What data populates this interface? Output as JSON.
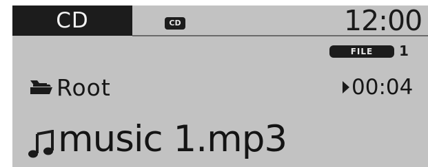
{
  "header": {
    "mode_label": "CD",
    "source_badge": "CD",
    "clock": "12:00"
  },
  "file_info": {
    "badge_label": "FILE",
    "number": "1"
  },
  "folder": {
    "icon": "folder-icon",
    "name": "Root"
  },
  "playback": {
    "icon": "play-icon",
    "elapsed": "00:04"
  },
  "track": {
    "icon": "music-note-icon",
    "name": "music 1.mp3"
  },
  "colors": {
    "screen_background": "#c2c2c2",
    "tab_background": "#1c1c1c",
    "text": "#151515"
  }
}
